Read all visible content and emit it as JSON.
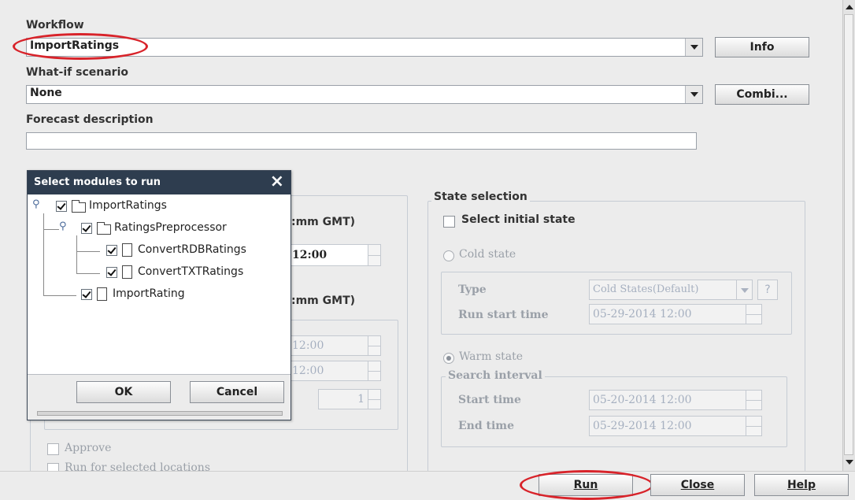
{
  "workflow": {
    "label": "Workflow",
    "value": "ImportRatings",
    "info_label": "Info"
  },
  "whatif": {
    "label": "What-if scenario",
    "value": "None",
    "combi_label": "Combi..."
  },
  "forecast": {
    "label": "Forecast description",
    "value": ""
  },
  "bg_labels": {
    "t0_suffix": ":mm  GMT)",
    "t1_suffix": ":mm  GMT)",
    "t0_value": "12:00",
    "d1": "12:00",
    "d2": "12:00",
    "count": "1"
  },
  "checks": {
    "approve": "Approve",
    "run_selected": "Run for selected locations"
  },
  "state": {
    "title": "State selection",
    "select_initial": "Select initial state",
    "cold": "Cold state",
    "type_label": "Type",
    "type_value": "Cold States(Default)",
    "help": "?",
    "run_start_label": "Run start time",
    "run_start_value": "05-29-2014 12:00",
    "warm": "Warm state",
    "search_interval": "Search interval",
    "start_label": "Start time",
    "start_value": "05-20-2014 12:00",
    "end_label": "End time",
    "end_value": "05-29-2014 12:00"
  },
  "modal": {
    "title": "Select modules to run",
    "close": "×",
    "tree": [
      {
        "label": "ImportRatings"
      },
      {
        "label": "RatingsPreprocessor"
      },
      {
        "label": "ConvertRDBRatings"
      },
      {
        "label": "ConvertTXTRatings"
      },
      {
        "label": "ImportRating"
      }
    ],
    "ok": "OK",
    "cancel": "Cancel"
  },
  "footer": {
    "run": "Run",
    "close": "Close",
    "help": "Help"
  },
  "colors": {
    "highlight": "#d8232a",
    "window_bg": "#ececec",
    "modal_title_bg": "#2e3d4f"
  }
}
